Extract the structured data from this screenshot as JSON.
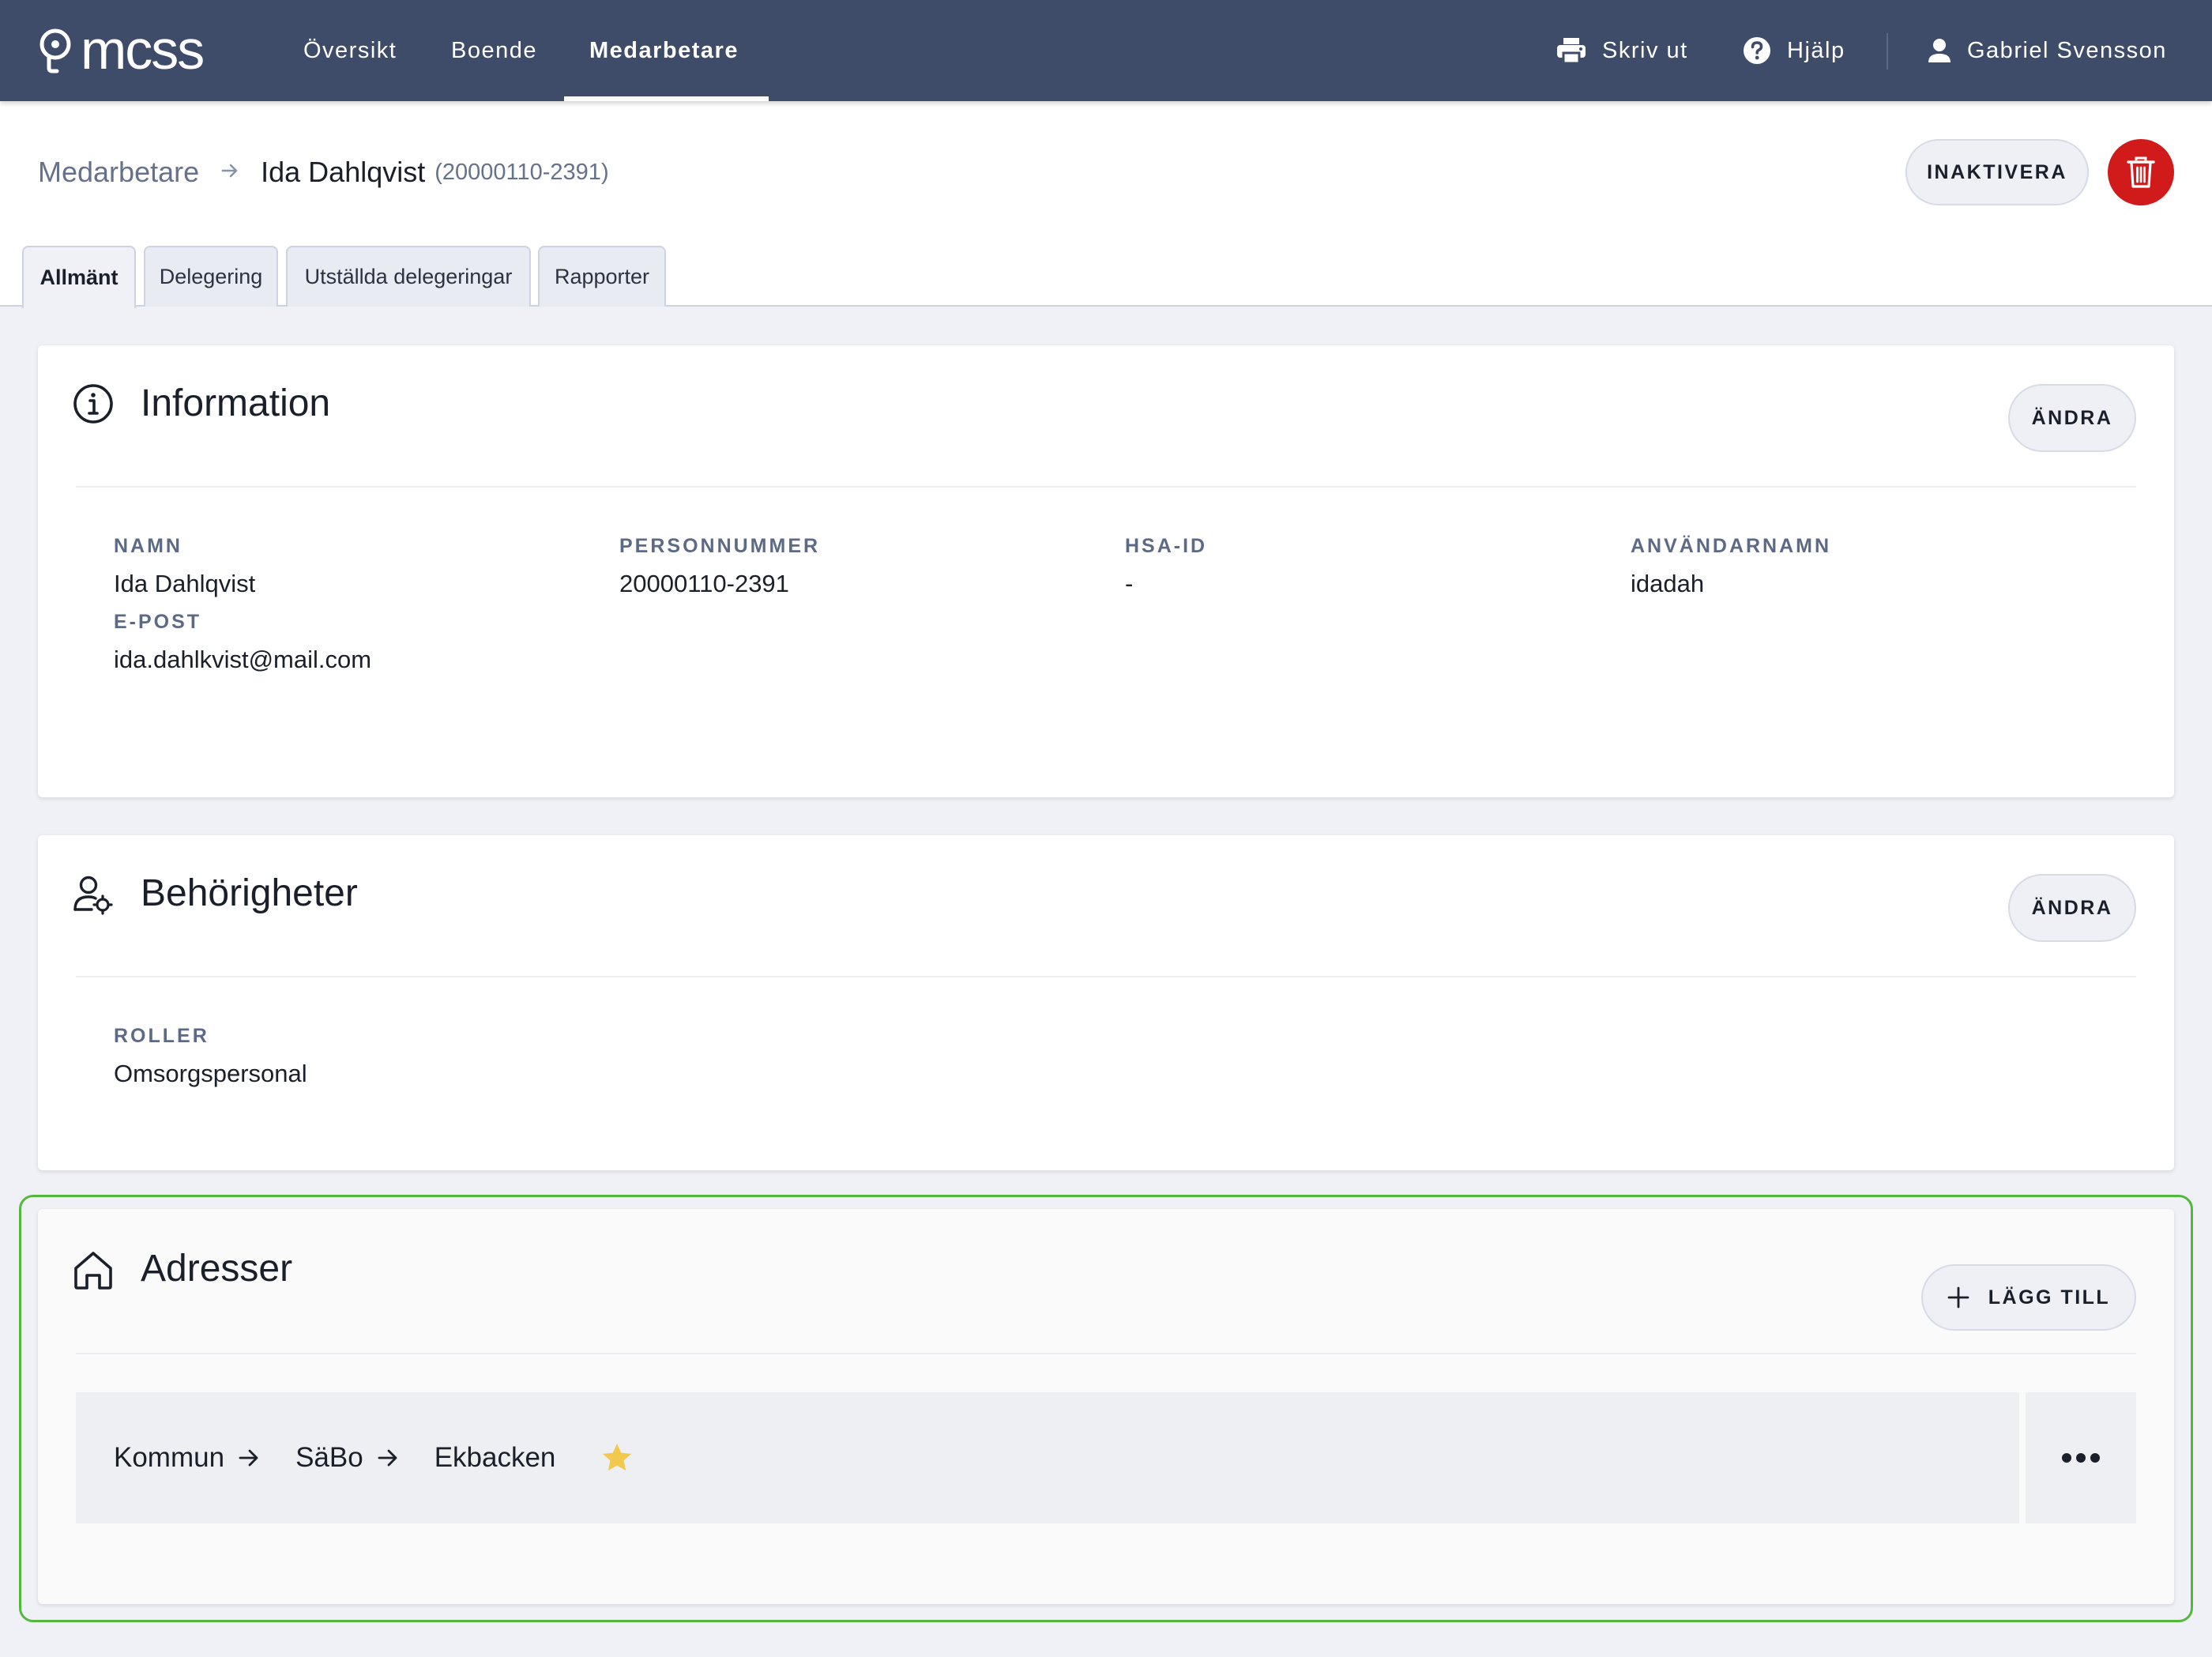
{
  "app": {
    "logo_text": "mcss",
    "nav": [
      {
        "label": "Översikt",
        "active": false
      },
      {
        "label": "Boende",
        "active": false
      },
      {
        "label": "Medarbetare",
        "active": true
      }
    ],
    "print_label": "Skriv ut",
    "help_label": "Hjälp",
    "user_name": "Gabriel Svensson"
  },
  "breadcrumb": {
    "parent": "Medarbetare",
    "current": "Ida Dahlqvist",
    "sub": "(20000110-2391)"
  },
  "actions": {
    "deactivate_label": "INAKTIVERA",
    "delete_icon": "trash-icon"
  },
  "tabs": [
    {
      "label": "Allmänt",
      "active": true
    },
    {
      "label": "Delegering",
      "active": false
    },
    {
      "label": "Utställda delegeringar",
      "active": false
    },
    {
      "label": "Rapporter",
      "active": false
    }
  ],
  "information": {
    "title": "Information",
    "edit_label": "ÄNDRA",
    "fields": {
      "namn_label": "NAMN",
      "namn_value": "Ida Dahlqvist",
      "personnummer_label": "PERSONNUMMER",
      "personnummer_value": "20000110-2391",
      "hsaid_label": "HSA-ID",
      "hsaid_value": "-",
      "anvandarnamn_label": "ANVÄNDARNAMN",
      "anvandarnamn_value": "idadah",
      "epost_label": "E-POST",
      "epost_value": "ida.dahlkvist@mail.com"
    }
  },
  "permissions": {
    "title": "Behörigheter",
    "edit_label": "ÄNDRA",
    "roles_label": "ROLLER",
    "roles_value": "Omsorgspersonal"
  },
  "addresses": {
    "title": "Adresser",
    "add_label": "LÄGG TILL",
    "rows": [
      {
        "path": [
          "Kommun",
          "SäBo",
          "Ekbacken"
        ],
        "favorite": true
      }
    ]
  },
  "colors": {
    "topbar": "#3e4c69",
    "danger": "#d11b1b",
    "highlight": "#55b83e",
    "star": "#f2c94c"
  }
}
